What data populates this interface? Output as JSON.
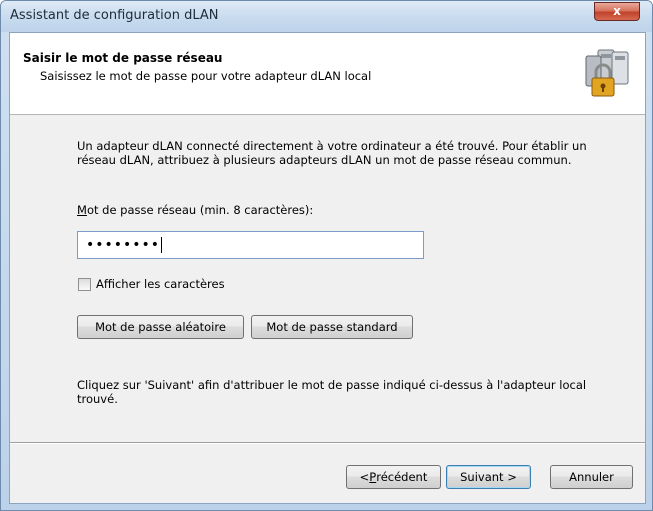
{
  "window": {
    "title": "Assistant de configuration dLAN",
    "close_glyph": "x"
  },
  "header": {
    "title": "Saisir le mot de passe réseau",
    "subtitle": "Saisissez le mot de passe pour votre adapteur dLAN local",
    "icon": "dlan-adapters-lock-icon"
  },
  "body": {
    "intro": "Un adapteur dLAN connecté directement à votre ordinateur a été trouvé. Pour établir un réseau dLAN, attribuez à plusieurs adapteurs dLAN un mot de passe réseau commun.",
    "password_label_access": "M",
    "password_label_rest": "ot de passe réseau (min. 8 caractères):",
    "password_value_masked": "••••••••",
    "show_chars_label": "Afficher les caractères",
    "show_chars_checked": false,
    "random_button": "Mot de passe aléatoire",
    "standard_button": "Mot de passe standard",
    "footer": "Cliquez sur 'Suivant' afin d'attribuer le mot de passe indiqué ci-dessus à l'adapteur local trouvé."
  },
  "nav": {
    "back_prefix": "< ",
    "back_access": "P",
    "back_rest": "récédent",
    "next": "Suivant >",
    "cancel": "Annuler"
  },
  "colors": {
    "title_bar": "#c9dcef",
    "close_button": "#c1412a",
    "dialog_bg": "#f0f0f0",
    "input_border": "#7a9cc7"
  }
}
